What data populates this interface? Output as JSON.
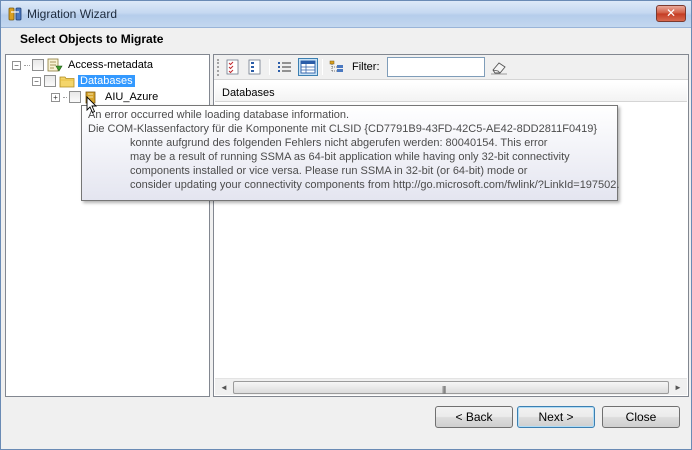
{
  "window": {
    "title": "Migration Wizard",
    "close_label": "✕"
  },
  "header": {
    "title": "Select Objects to Migrate"
  },
  "tree": {
    "root": {
      "label": "Access-metadata",
      "expander": "−"
    },
    "databases": {
      "label": "Databases",
      "expander": "−",
      "selected": true
    },
    "item": {
      "label": "AIU_Azure",
      "expander": "+"
    }
  },
  "toolbar": {
    "filter_label": "Filter:",
    "filter_value": ""
  },
  "grid": {
    "header": "Databases"
  },
  "tooltip": {
    "lines": [
      "An error occurred while loading database information.",
      "Die COM-Klassenfactory für die Komponente mit CLSID {CD7791B9-43FD-42C5-AE42-8DD2811F0419}",
      "konnte aufgrund des folgenden Fehlers nicht abgerufen werden: 80040154. This error",
      "may be a result of running SSMA as 64-bit application while having only 32-bit connectivity",
      "components installed or vice versa. Please run SSMA in 32-bit (or 64-bit) mode or",
      "consider updating your connectivity components from http://go.microsoft.com/fwlink/?LinkId=197502."
    ]
  },
  "scrollbar": {
    "left_arrow": "◄",
    "right_arrow": "►",
    "grip": "|||"
  },
  "buttons": {
    "back": "< Back",
    "next": "Next >",
    "close": "Close"
  },
  "colors": {
    "selection": "#3399ff",
    "title_gradient_top": "#dde9f8",
    "close_red": "#c43b22"
  }
}
